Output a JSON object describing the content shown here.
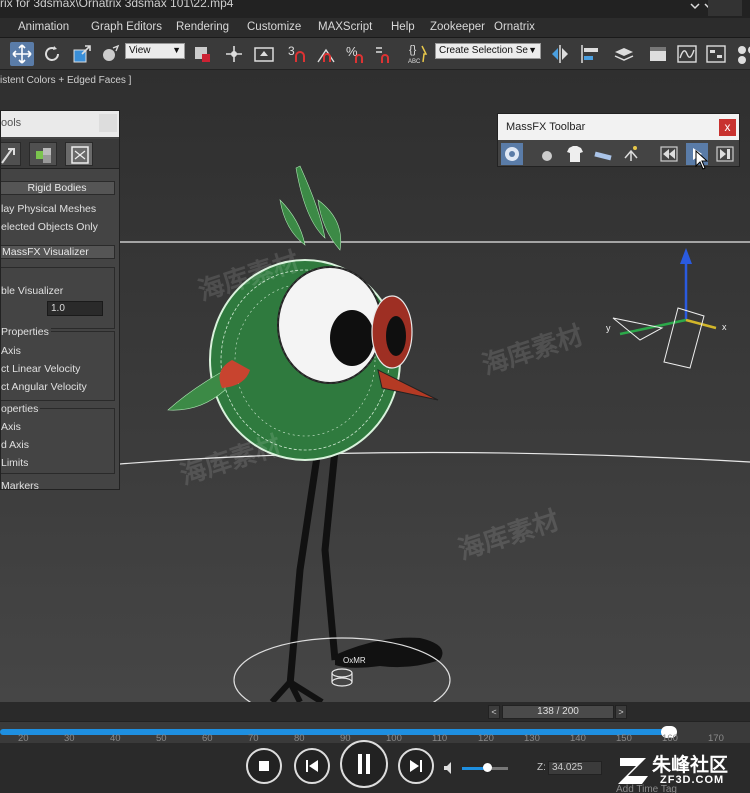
{
  "window": {
    "title": "rix for 3dsmax\\Ornatrix 3dsmax 101\\22.mp4"
  },
  "menu": [
    "Animation",
    "Graph Editors",
    "Rendering",
    "Customize",
    "MAXScript",
    "Help",
    "Zookeeper",
    "Ornatrix"
  ],
  "toolbar": {
    "view_dropdown": "View",
    "selection_set_placeholder": "Create Selection Se",
    "labels": {
      "angle_snap": "3",
      "percent_snap": "%",
      "abc": "ABC"
    }
  },
  "viewport": {
    "shading_label": "istent Colors + Edged Faces ]",
    "watermark": "海库素材",
    "axis_labels": {
      "x": "x",
      "y": "y"
    },
    "object_label": "OxMR"
  },
  "tools_panel": {
    "title": "ools",
    "rigid_bodies_header": "Rigid Bodies",
    "display_physical_meshes": "lay Physical Meshes",
    "selected_objects_only": "elected Objects Only",
    "visualizer_header": "MassFX Visualizer",
    "enable_visualizer": "ble Visualizer",
    "scale_value": "1.0",
    "properties_group": "Properties",
    "axis": "Axis",
    "linear_velocity": "ct Linear Velocity",
    "angular_velocity": "ct Angular Velocity",
    "properties_group_2": "operties",
    "axis_2": "Axis",
    "d_axis": "d Axis",
    "limits": "Limits",
    "markers": "Markers"
  },
  "massfx_toolbar": {
    "title": "MassFX Toolbar",
    "close": "x"
  },
  "timeline": {
    "frame_counter": "138 / 200",
    "prev": "<",
    "next": ">",
    "ticks": [
      "20",
      "30",
      "40",
      "50",
      "60",
      "70",
      "80",
      "90",
      "100",
      "110",
      "120",
      "130",
      "140",
      "150",
      "160",
      "170"
    ],
    "progress": 0.94
  },
  "player": {
    "volume": 0.55,
    "z_label": "Z:",
    "z_value": "34.025",
    "add_time_tag": "Add Time Tag"
  },
  "brand": {
    "name": "朱峰社区",
    "url": "ZF3D.COM"
  },
  "colors": {
    "accent": "#1e8fe0",
    "massfx_close": "#c8322f",
    "toolbar_active": "#5a7ca8"
  }
}
